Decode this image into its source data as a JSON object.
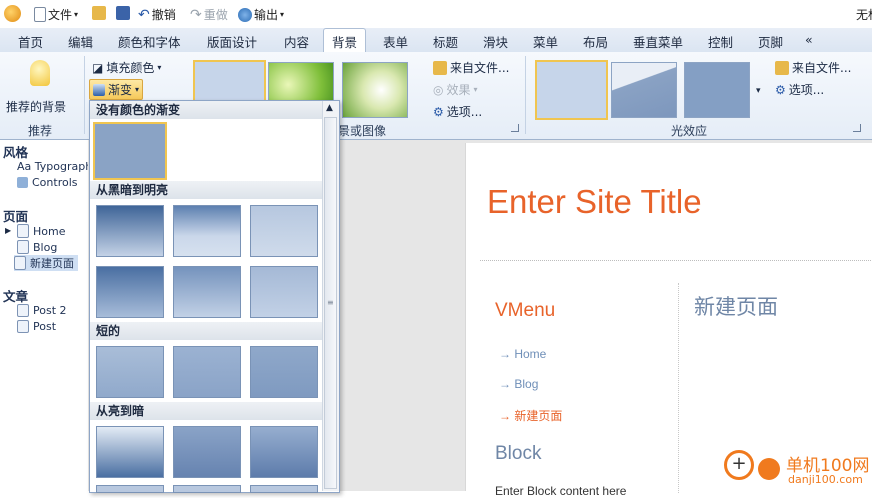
{
  "quick_access": {
    "file": "文件",
    "undo": "撤销",
    "redo": "重做",
    "export": "输出",
    "window_title": "无标"
  },
  "tabs": [
    "首页",
    "编辑",
    "颜色和字体",
    "版面设计",
    "内容",
    "背景",
    "表单",
    "标题",
    "滑块",
    "菜单",
    "布局",
    "垂直菜单",
    "控制",
    "页脚",
    "«"
  ],
  "active_tab": "背景",
  "ribbon": {
    "recommended_bg": "推荐的背景",
    "recommend_group": "推荐",
    "fill_color": "填充颜色",
    "gradient": "渐变",
    "from_file_1": "来自文件...",
    "effects": "效果",
    "options_1": "选项...",
    "bg_image_group": "景或图像",
    "from_file_2": "来自文件...",
    "options_2": "选项...",
    "light_effect_group": "光效应"
  },
  "left_panel": {
    "style_section": "风格",
    "typography": "Aa Typography",
    "controls": "Controls",
    "pages_section": "页面",
    "pages": [
      "Home",
      "Blog",
      "新建页面"
    ],
    "posts_section": "文章",
    "posts": [
      "Post 2",
      "Post"
    ]
  },
  "dropdown": {
    "sections": [
      "没有颜色的渐变",
      "从黑暗到明亮",
      "短的",
      "从亮到暗"
    ]
  },
  "site": {
    "title": "Enter Site Title",
    "vmenu_title": "VMenu",
    "vmenu_items": [
      "Home",
      "Blog",
      "新建页面"
    ],
    "block_title": "Block",
    "block_content": "Enter Block content here",
    "page_heading": "新建页面",
    "accent": "#e8632a"
  },
  "watermark": {
    "cn": "单机100网",
    "url": "danji100.com"
  }
}
